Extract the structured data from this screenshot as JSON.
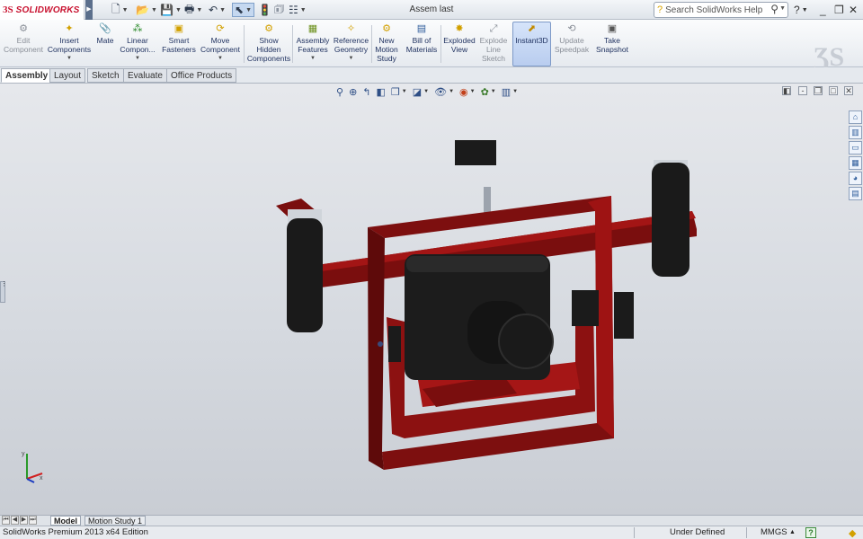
{
  "app": {
    "logo_ds": "3S",
    "logo_text": "SOLIDWORKS",
    "document_title": "Assem last"
  },
  "search": {
    "placeholder": "Search SolidWorks Help"
  },
  "quick_access": [
    "new-document-icon",
    "open-icon",
    "save-icon",
    "print-icon",
    "undo-icon",
    "select-icon",
    "rebuild-icon",
    "file-properties-icon",
    "options-icon"
  ],
  "commands": [
    {
      "label": "Edit Component",
      "icon": "edit-component-icon",
      "disabled": true
    },
    {
      "label": "Insert Components",
      "icon": "insert-components-icon"
    },
    {
      "label": "Mate",
      "icon": "mate-icon"
    },
    {
      "label": "Linear Compon...",
      "icon": "linear-pattern-icon"
    },
    {
      "label": "Smart Fasteners",
      "icon": "smart-fasteners-icon"
    },
    {
      "label": "Move Component",
      "icon": "move-component-icon"
    },
    {
      "label": "Show Hidden Components",
      "icon": "show-hidden-icon"
    },
    {
      "label": "Assembly Features",
      "icon": "assembly-features-icon"
    },
    {
      "label": "Reference Geometry",
      "icon": "reference-geometry-icon"
    },
    {
      "label": "New Motion Study",
      "icon": "motion-study-icon"
    },
    {
      "label": "Bill of Materials",
      "icon": "bom-icon"
    },
    {
      "label": "Exploded View",
      "icon": "exploded-view-icon"
    },
    {
      "label": "Explode Line Sketch",
      "icon": "explode-line-icon",
      "disabled": true
    },
    {
      "label": "Instant3D",
      "icon": "instant3d-icon",
      "active": true
    },
    {
      "label": "Update Speedpak",
      "icon": "speedpak-icon",
      "disabled": true
    },
    {
      "label": "Take Snapshot",
      "icon": "snapshot-icon"
    }
  ],
  "tabs": [
    {
      "label": "Assembly",
      "active": true
    },
    {
      "label": "Layout"
    },
    {
      "label": "Sketch"
    },
    {
      "label": "Evaluate"
    },
    {
      "label": "Office Products"
    }
  ],
  "bottom_tabs": [
    {
      "label": "Model",
      "active": true
    },
    {
      "label": "Motion Study 1"
    }
  ],
  "status": {
    "edition": "SolidWorks Premium 2013 x64 Edition",
    "state": "Under Defined",
    "units": "MMGS",
    "units_arrow": "▲",
    "help_label": "?"
  },
  "colors": {
    "frame": "#8b0f0f",
    "handles": "#1b1b1b",
    "brand": "#c8102e",
    "instant3d_active": "#b9cdef"
  }
}
